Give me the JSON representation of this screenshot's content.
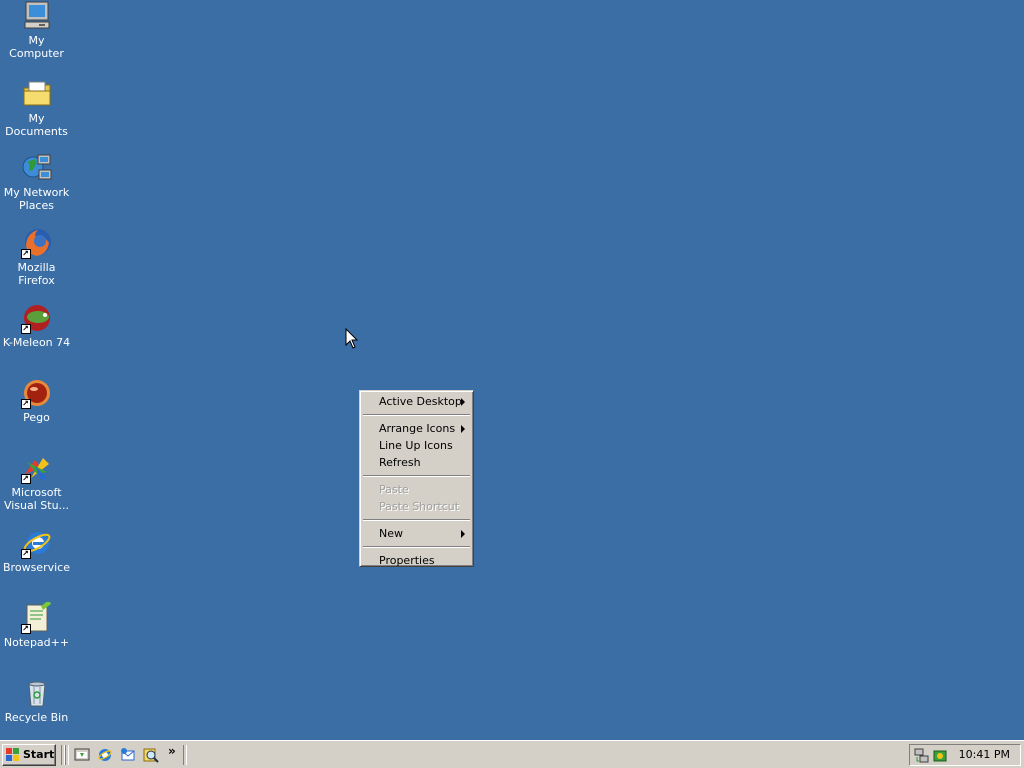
{
  "desktop": {
    "background": "#3a6ea5",
    "icons": [
      {
        "label": "My Computer",
        "icon": "computer-icon"
      },
      {
        "label": "My Documents",
        "icon": "folder-icon"
      },
      {
        "label": "My Network Places",
        "icon": "network-icon"
      },
      {
        "label": "Mozilla Firefox",
        "icon": "firefox-icon"
      },
      {
        "label": "K-Meleon 74",
        "icon": "kmeleon-icon"
      },
      {
        "label": "Pego",
        "icon": "pego-icon"
      },
      {
        "label": "Microsoft Visual Stu...",
        "icon": "visual-studio-icon"
      },
      {
        "label": "Browservice",
        "icon": "ie-icon"
      },
      {
        "label": "Notepad++",
        "icon": "notepad-icon"
      },
      {
        "label": "Recycle Bin",
        "icon": "recycle-bin-icon"
      }
    ]
  },
  "context_menu": {
    "items": [
      {
        "label": "Active Desktop",
        "submenu": true,
        "enabled": true
      },
      {
        "label": "Arrange Icons",
        "submenu": true,
        "enabled": true
      },
      {
        "label": "Line Up Icons",
        "submenu": false,
        "enabled": true
      },
      {
        "label": "Refresh",
        "submenu": false,
        "enabled": true
      },
      {
        "label": "Paste",
        "submenu": false,
        "enabled": false
      },
      {
        "label": "Paste Shortcut",
        "submenu": false,
        "enabled": false
      },
      {
        "label": "New",
        "submenu": true,
        "enabled": true
      },
      {
        "label": "Properties",
        "submenu": false,
        "enabled": true
      }
    ]
  },
  "taskbar": {
    "start_label": "Start",
    "quick_launch": [
      "show-desktop-icon",
      "ie-icon",
      "outlook-icon",
      "search-icon"
    ],
    "chevron": "»",
    "tray_icons": [
      "network-tray-icon",
      "security-tray-icon"
    ],
    "clock": "10:41 PM"
  }
}
